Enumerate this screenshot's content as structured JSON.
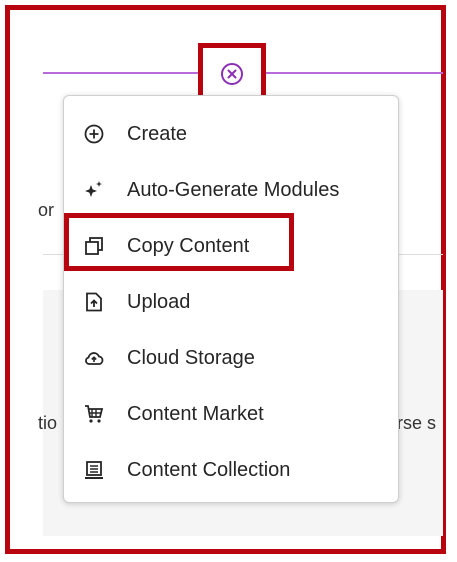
{
  "menu": {
    "items": [
      {
        "label": "Create",
        "icon": "plus-circle-icon"
      },
      {
        "label": "Auto-Generate Modules",
        "icon": "sparkle-icon"
      },
      {
        "label": "Copy Content",
        "icon": "copy-icon"
      },
      {
        "label": "Upload",
        "icon": "upload-file-icon"
      },
      {
        "label": "Cloud Storage",
        "icon": "cloud-upload-icon"
      },
      {
        "label": "Content Market",
        "icon": "cart-icon"
      },
      {
        "label": "Content Collection",
        "icon": "collection-icon"
      }
    ]
  },
  "background": {
    "fragment_left_1": "or",
    "fragment_left_2": "tio",
    "fragment_right_2": "rse s"
  },
  "colors": {
    "highlight": "#b7040f",
    "accent_purple": "#b66bd9"
  }
}
